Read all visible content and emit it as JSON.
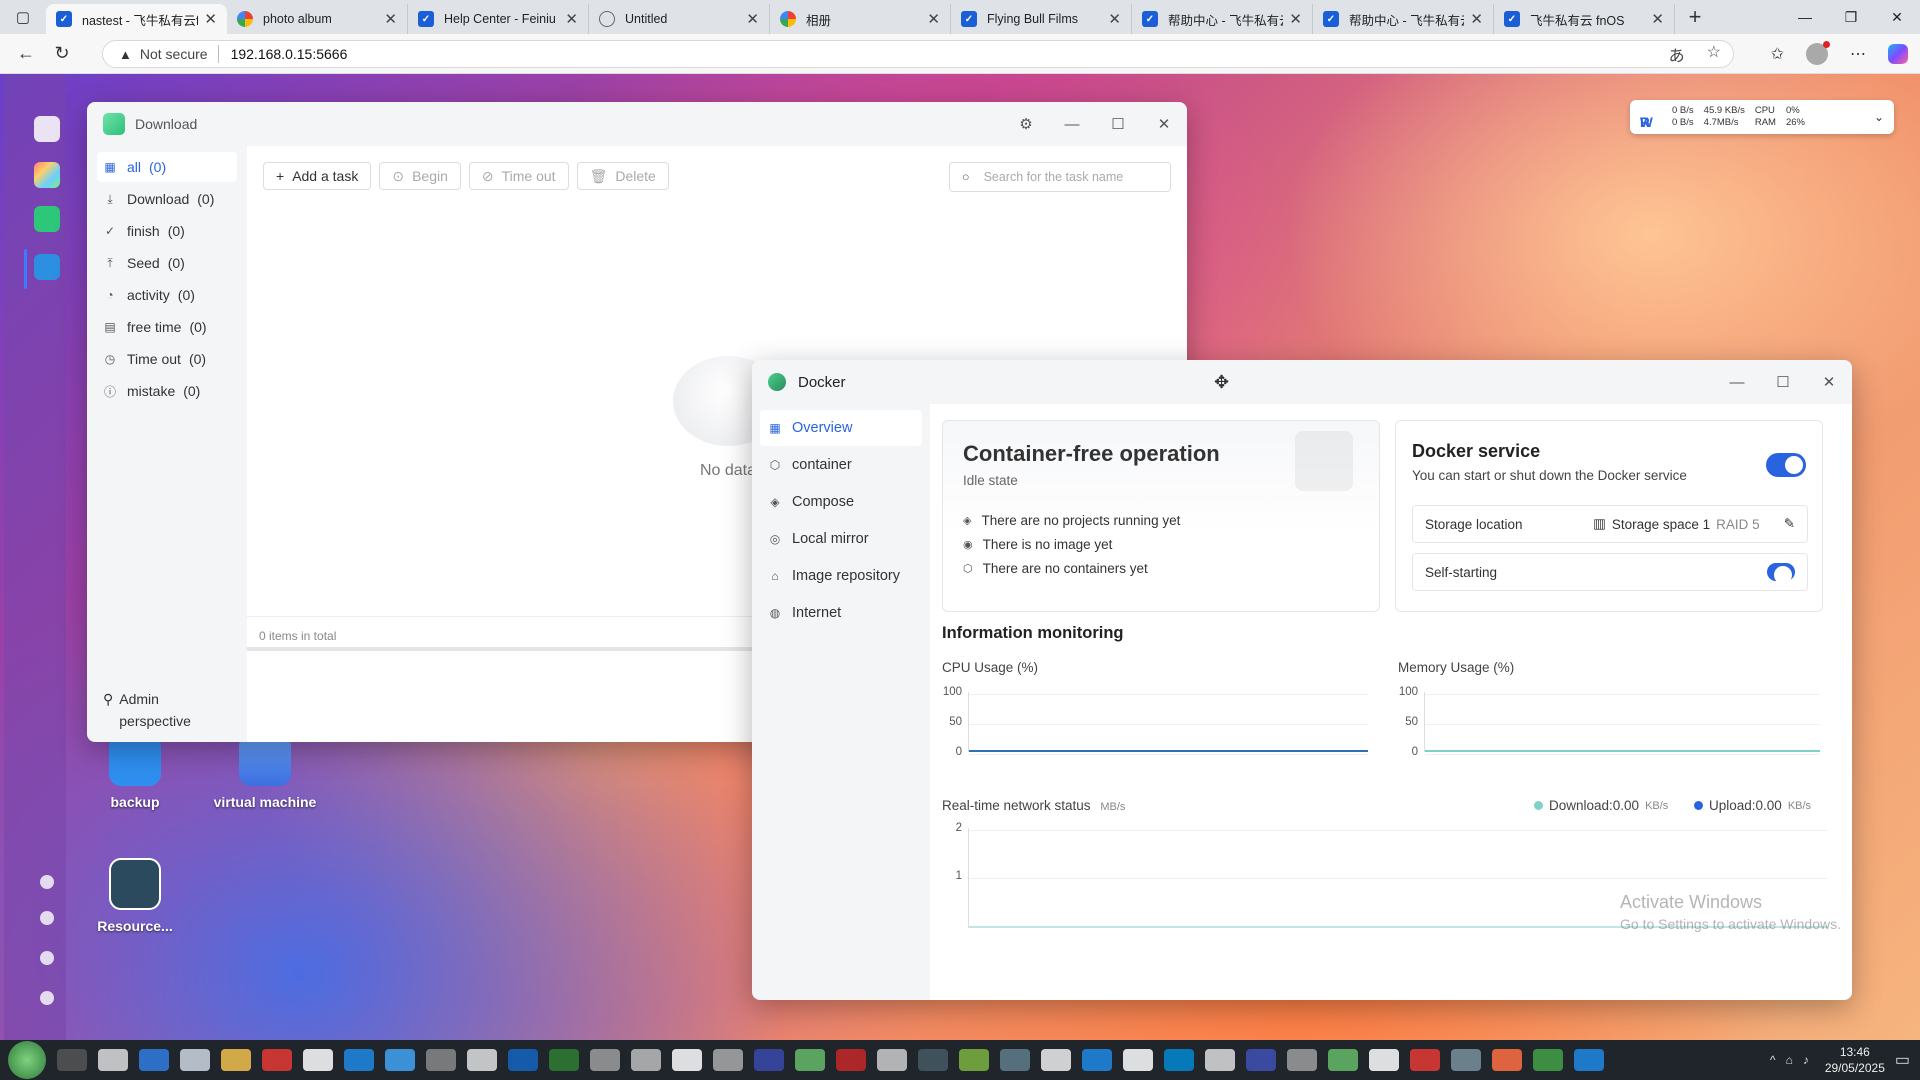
{
  "browser": {
    "tabs": [
      {
        "title": "nastest - 飞牛私有云fn",
        "favicon": "blue-check",
        "active": true
      },
      {
        "title": "photo album",
        "favicon": "multicolor",
        "active": false
      },
      {
        "title": "Help Center - Feiniu Pr",
        "favicon": "blue-check",
        "active": false
      },
      {
        "title": "Untitled",
        "favicon": "globe",
        "active": false
      },
      {
        "title": "相册",
        "favicon": "multicolor",
        "active": false
      },
      {
        "title": "Flying Bull Films",
        "favicon": "blue-check",
        "active": false
      },
      {
        "title": "帮助中心 - 飞牛私有云",
        "favicon": "blue-check",
        "active": false
      },
      {
        "title": "帮助中心 - 飞牛私有云",
        "favicon": "blue-check",
        "active": false
      },
      {
        "title": "飞牛私有云 fnOS",
        "favicon": "blue-check",
        "active": false
      }
    ],
    "security_label": "Not secure",
    "url": "192.168.0.15:5666"
  },
  "netwidget": {
    "r_label": "R",
    "w_label": "W",
    "r_local": "0 B/s",
    "w_local": "0 B/s",
    "r_net": "45.9 KB/s",
    "w_net": "4.7MB/s",
    "cpu_label": "CPU",
    "ram_label": "RAM",
    "cpu": "0%",
    "ram": "26%"
  },
  "desktop_icons": [
    {
      "label": "backup",
      "icon": "backup-icon"
    },
    {
      "label": "virtual machine",
      "icon": "vm-icon"
    },
    {
      "label": "Resource...",
      "icon": "resource-monitor-icon"
    }
  ],
  "download_window": {
    "title": "Download",
    "sidebar": [
      {
        "label": "all",
        "count": "(0)",
        "icon": "grid-icon"
      },
      {
        "label": "Download",
        "count": "(0)",
        "icon": "download-icon"
      },
      {
        "label": "finish",
        "count": "(0)",
        "icon": "check-circle-icon"
      },
      {
        "label": "Seed",
        "count": "(0)",
        "icon": "upload-icon"
      },
      {
        "label": "activity",
        "count": "(0)",
        "icon": "activity-icon"
      },
      {
        "label": "free time",
        "count": "(0)",
        "icon": "pause-icon"
      },
      {
        "label": "Time out",
        "count": "(0)",
        "icon": "clock-icon"
      },
      {
        "label": "mistake",
        "count": "(0)",
        "icon": "error-icon"
      }
    ],
    "admin_label": "Admin perspective",
    "toolbar": {
      "add": "Add a task",
      "begin": "Begin",
      "timeout": "Time out",
      "delete": "Delete"
    },
    "search_placeholder": "Search for the task name",
    "empty_text": "No data",
    "footer_text": "0 items in total"
  },
  "docker_window": {
    "title": "Docker",
    "nav": [
      {
        "label": "Overview",
        "icon": "grid-icon"
      },
      {
        "label": "container",
        "icon": "box-icon"
      },
      {
        "label": "Compose",
        "icon": "layers-icon"
      },
      {
        "label": "Local mirror",
        "icon": "mirror-icon"
      },
      {
        "label": "Image repository",
        "icon": "home-icon"
      },
      {
        "label": "Internet",
        "icon": "globe-icon"
      }
    ],
    "status_card": {
      "title": "Container-free operation",
      "state": "Idle state",
      "items": [
        "There are no projects running yet",
        "There is no image yet",
        "There are no containers yet"
      ]
    },
    "service_card": {
      "title": "Docker service",
      "description": "You can start or shut down the Docker service",
      "enabled": true,
      "storage_label": "Storage location",
      "storage_value": "Storage space 1",
      "storage_raid": "RAID 5",
      "autostart_label": "Self-starting",
      "autostart_enabled": true
    },
    "monitoring": {
      "heading": "Information monitoring",
      "cpu_label": "CPU Usage (%)",
      "mem_label": "Memory Usage (%)",
      "net_label": "Real-time network status",
      "net_unit": "MB/s",
      "download_label": "Download:0.00",
      "upload_label": "Upload:0.00",
      "rate_unit": "KB/s",
      "download_color": "#7fd0c8",
      "upload_color": "#2a63e0"
    }
  },
  "chart_data": [
    {
      "type": "line",
      "title": "CPU Usage (%)",
      "ylim": [
        0,
        100
      ],
      "yticks": [
        "100",
        "50",
        "0"
      ],
      "series": [
        {
          "values": [
            0,
            0
          ]
        }
      ]
    },
    {
      "type": "line",
      "title": "Memory Usage (%)",
      "ylim": [
        0,
        100
      ],
      "yticks": [
        "100",
        "50",
        "0"
      ],
      "series": [
        {
          "values": [
            0,
            0
          ]
        }
      ]
    },
    {
      "type": "line",
      "title": "Real-time network status",
      "ylabel": "MB/s",
      "yticks": [
        "2",
        "1"
      ],
      "series": [
        {
          "name": "Download",
          "values": [
            0,
            0
          ]
        },
        {
          "name": "Upload",
          "values": [
            0,
            0
          ]
        }
      ]
    }
  ],
  "watermark": {
    "line1": "Activate Windows",
    "line2": "Go to Settings to activate Windows."
  },
  "taskbar": {
    "time": "13:46",
    "date": "29/05/2025"
  }
}
